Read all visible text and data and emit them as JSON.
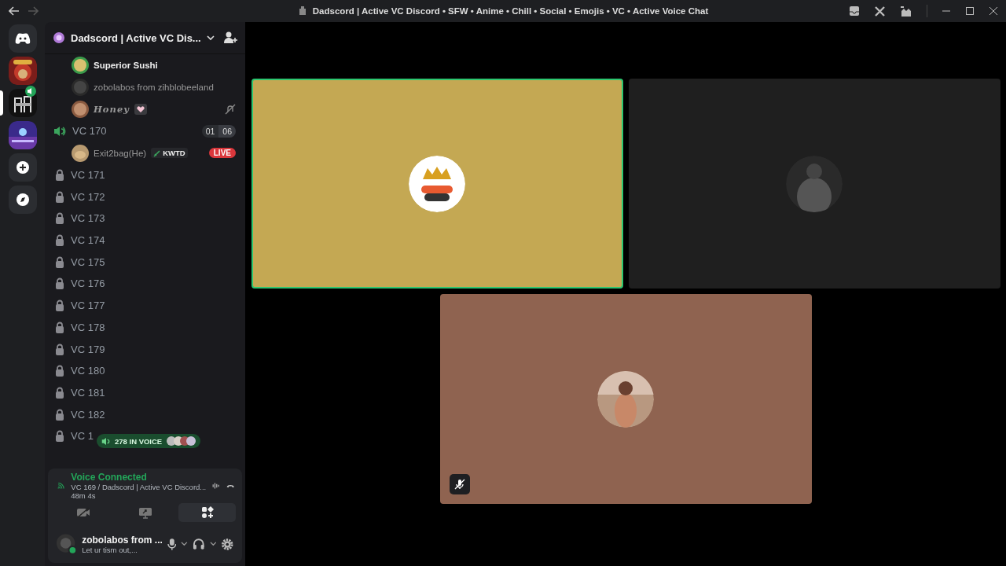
{
  "title_bar": {
    "title": "Dadscord | Active VC Discord • SFW • Anime • Chill • Social • Emojis • VC • Active Voice Chat"
  },
  "servers": [
    {
      "kind": "home",
      "selected": false,
      "speaking": false
    },
    {
      "kind": "picture",
      "selected": false,
      "speaking": false
    },
    {
      "kind": "picture",
      "selected": true,
      "speaking": true
    },
    {
      "kind": "picture",
      "selected": false,
      "speaking": false
    },
    {
      "kind": "add",
      "selected": false,
      "speaking": false
    },
    {
      "kind": "explore",
      "selected": false,
      "speaking": false
    }
  ],
  "server_header": {
    "name": "Dadscord | Active VC Dis..."
  },
  "channel_users": [
    {
      "name": "Superior Sushi",
      "bright": true,
      "heart": false,
      "deafened": false
    },
    {
      "name": "zobolabos from zihblobeeland",
      "bright": false,
      "heart": false,
      "deafened": false
    },
    {
      "name": "Honey",
      "bright": false,
      "heart": true,
      "deafened": true
    }
  ],
  "voice_channel": {
    "name": "VC 170",
    "count_a": "01",
    "count_b": "06",
    "users": [
      {
        "name": "Exit2bag(He)",
        "tag": "KWTD",
        "live": "LIVE"
      }
    ]
  },
  "locked_channels": [
    {
      "name": "VC 171"
    },
    {
      "name": "VC 172"
    },
    {
      "name": "VC 173"
    },
    {
      "name": "VC 174"
    },
    {
      "name": "VC 175"
    },
    {
      "name": "VC 176"
    },
    {
      "name": "VC 177"
    },
    {
      "name": "VC 178"
    },
    {
      "name": "VC 179"
    },
    {
      "name": "VC 180"
    },
    {
      "name": "VC 181"
    },
    {
      "name": "VC 182"
    },
    {
      "name": "VC 1"
    }
  ],
  "voice_badge": {
    "text": "278 IN VOICE"
  },
  "voice_panel": {
    "status": "Voice Connected",
    "channel": "VC 169 / Dadscord | Active VC Discord...",
    "elapsed": "48m  4s"
  },
  "user_panel": {
    "name": "zobolabos from ...",
    "status": "Let ur tism out,..."
  },
  "tiles": [
    {
      "color": "#c4a853",
      "speaking": true,
      "muted": false
    },
    {
      "color": "#1f1f1f",
      "speaking": false,
      "muted": false
    },
    {
      "color": "#8f6350",
      "speaking": false,
      "muted": true
    }
  ]
}
